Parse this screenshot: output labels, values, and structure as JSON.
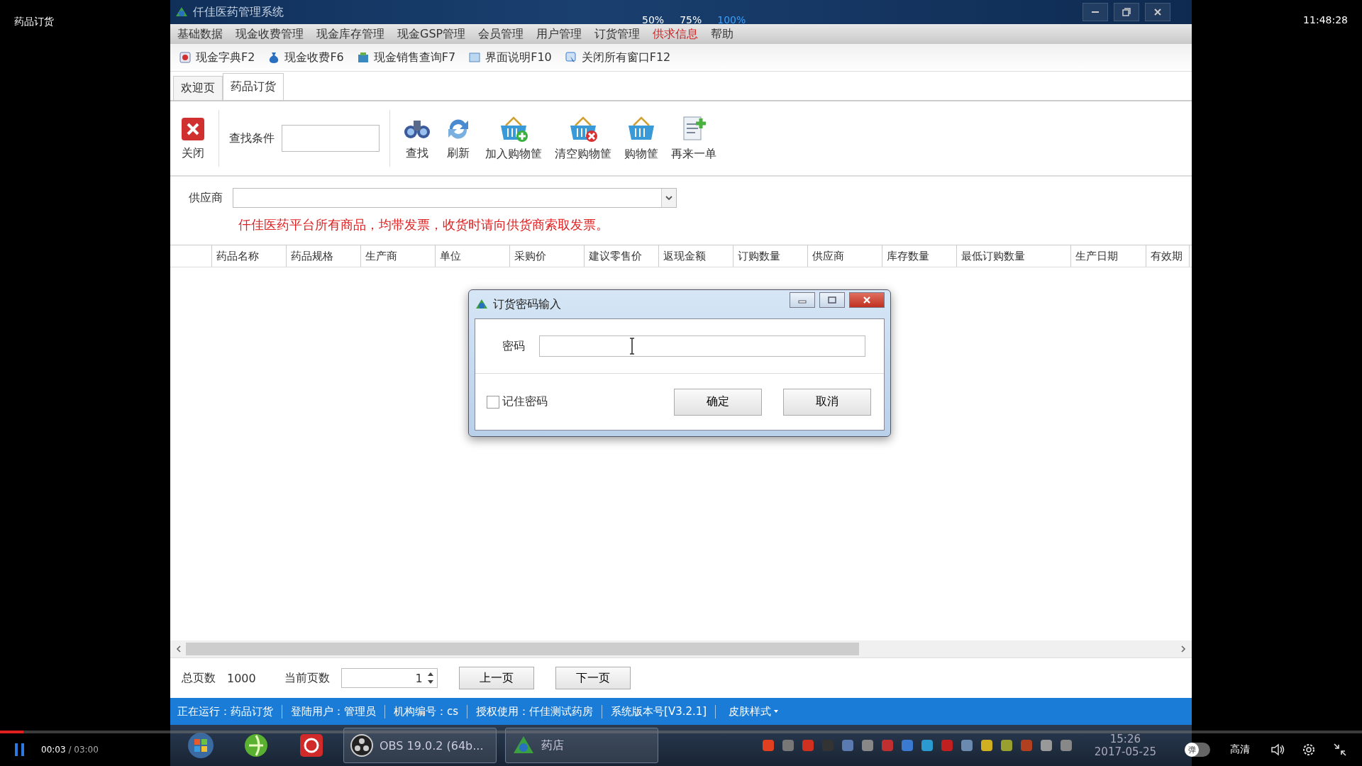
{
  "player": {
    "video_title": "药品订货",
    "clock": "11:48:28",
    "zoom_options": [
      {
        "label": "50%",
        "selected": false
      },
      {
        "label": "75%",
        "selected": false
      },
      {
        "label": "100%",
        "selected": true
      }
    ],
    "elapsed": "00:03",
    "duration": "/ 03:00",
    "level": 0.017,
    "danmaku_label": "弹",
    "danmaku_on": false,
    "quality": "高清",
    "paused": false
  },
  "app": {
    "window_title": "仟佳医药管理系统",
    "menu": [
      {
        "label": "基础数据",
        "highlighted": false
      },
      {
        "label": "现金收费管理",
        "highlighted": false
      },
      {
        "label": "现金库存管理",
        "highlighted": false
      },
      {
        "label": "现金GSP管理",
        "highlighted": false
      },
      {
        "label": "会员管理",
        "highlighted": false
      },
      {
        "label": "用户管理",
        "highlighted": false
      },
      {
        "label": "订货管理",
        "highlighted": false
      },
      {
        "label": "供求信息",
        "highlighted": true
      },
      {
        "label": "帮助",
        "highlighted": false
      }
    ],
    "quick_bar": [
      {
        "label": "现金字典F2",
        "kind": "dictionary"
      },
      {
        "label": "现金收费F6",
        "kind": "charge"
      },
      {
        "label": "现金销售查询F7",
        "kind": "sales"
      },
      {
        "label": "界面说明F10",
        "kind": "help"
      },
      {
        "label": "关闭所有窗口F12",
        "kind": "close-all"
      }
    ],
    "tabs": [
      {
        "label": "欢迎页",
        "selected": false
      },
      {
        "label": "药品订货",
        "selected": true
      }
    ],
    "toolbar": {
      "close_label": "关闭",
      "search_label": "查找条件",
      "buttons": [
        {
          "label": "查找",
          "kind": "search"
        },
        {
          "label": "刷新",
          "kind": "refresh"
        },
        {
          "label": "加入购物筐",
          "kind": "add-cart"
        },
        {
          "label": "清空购物筐",
          "kind": "clear-cart"
        },
        {
          "label": "购物筐",
          "kind": "cart"
        },
        {
          "label": "再来一单",
          "kind": "new-order"
        }
      ]
    },
    "supplier_label": "供应商",
    "notice": "仟佳医药平台所有商品，均带发票，收货时请向供货商索取发票。",
    "columns": [
      "药品名称",
      "药品规格",
      "生产商",
      "单位",
      "采购价",
      "建议零售价",
      "返现金额",
      "订购数量",
      "供应商",
      "库存数量",
      "最低订购数量",
      "生产日期",
      "有效期"
    ],
    "pager": {
      "total_label": "总页数",
      "total": "1000",
      "current_label": "当前页数",
      "current": "1",
      "prev": "上一页",
      "next": "下一页"
    },
    "status": [
      "正在运行：药品订货",
      "登陆用户：管理员",
      "机构编号：cs",
      "授权使用：仟佳测试药房",
      "系统版本号[V3.2.1]"
    ],
    "skin": "皮肤样式"
  },
  "dialog": {
    "title": "订货密码输入",
    "password_label": "密码",
    "remember": {
      "label": "记住密码",
      "checked": false
    },
    "buttons": [
      "确定",
      "取消"
    ]
  },
  "taskbar": {
    "items": [
      {
        "kind": "start"
      },
      {
        "kind": "browser"
      },
      {
        "kind": "music"
      },
      {
        "kind": "obs",
        "label": "OBS 19.0.2 (64b..."
      },
      {
        "kind": "app",
        "label": "药店"
      }
    ],
    "time": "15:26",
    "date": "2017-05-25"
  }
}
